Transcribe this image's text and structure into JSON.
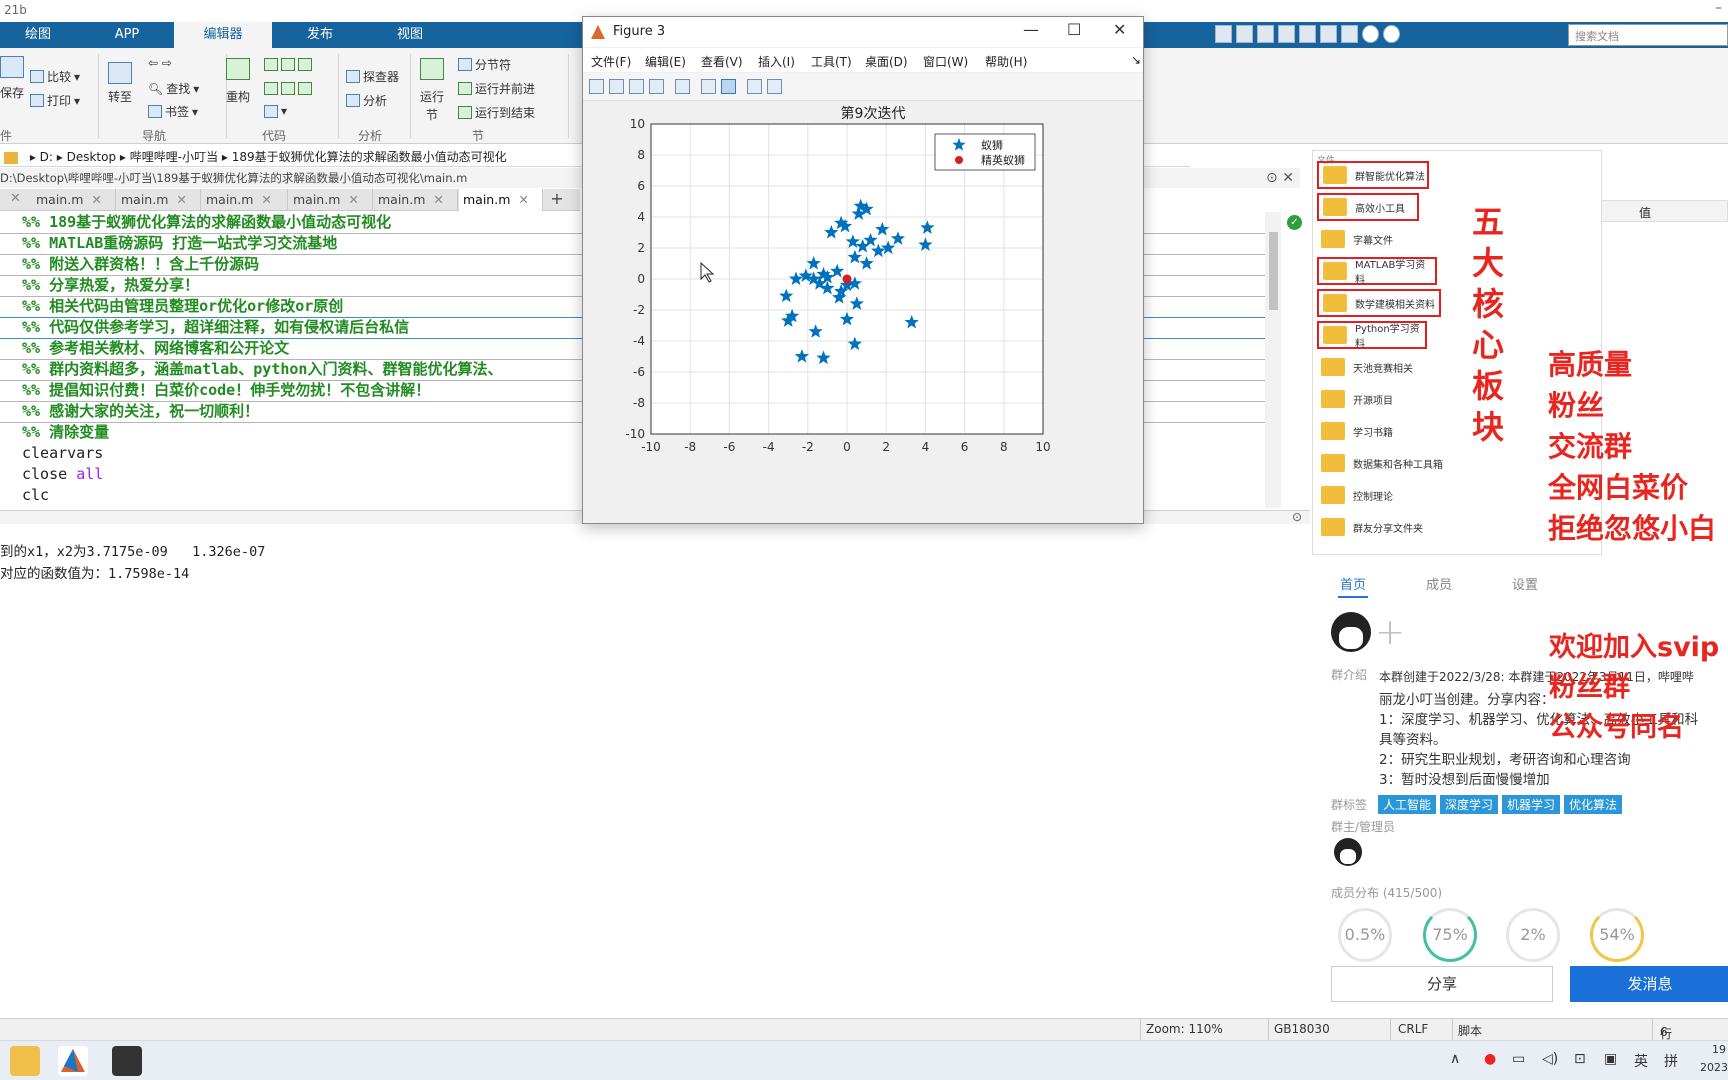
{
  "app": {
    "title_fragment": "21b",
    "minimize": "–"
  },
  "tabs": [
    "绘图",
    "APP",
    "编辑器",
    "发布",
    "视图"
  ],
  "doc_search_placeholder": "搜索文档",
  "ribbon": {
    "file": {
      "save": "保存",
      "section": "件"
    },
    "compare": "比较",
    "print": "打印",
    "goto": "转至",
    "find": "查找",
    "bookmark": "书签",
    "nav_section": "导航",
    "refactor": "重构",
    "code_section": "代码",
    "explorer": "探查器",
    "analyze": "分析",
    "analysis_section": "分析",
    "run_section_btn": "运行节",
    "run_section_top": "运行",
    "run_section_bot": "节",
    "section_break": "分节符",
    "run_advance": "运行并前进",
    "run_to_end": "运行到结束",
    "section_label": "节"
  },
  "address": [
    "D:",
    "Desktop",
    "哔哩哔哩-小叮当",
    "189基于蚁狮优化算法的求解函数最小值动态可视化"
  ],
  "filepath": "D:\\Desktop\\哔哩哔哩-小叮当\\189基于蚁狮优化算法的求解函数最小值动态可视化\\main.m",
  "file_tabs": [
    "main.m",
    "main.m",
    "main.m",
    "main.m",
    "main.m",
    "main.m"
  ],
  "code": {
    "c1": "%% 189基于蚁狮优化算法的求解函数最小值动态可视化",
    "c2": "%% MATLAB重磅源码 打造一站式学习交流基地",
    "c3": "%% 附送入群资格！！含上千份源码",
    "c4": "%% 分享热爱，热爱分享！",
    "c5": "%% 相关代码由管理员整理or优化or修改or原创",
    "c6": "%% 代码仅供参考学习，超详细注释，如有侵权请后台私信",
    "c7": "%% 参考相关教材、网络博客和公开论文",
    "c8": "%% 群内资料超多，涵盖matlab、python入门资料、群智能优化算法、",
    "c9": "%% 提倡知识付费！白菜价code！伸手党勿扰！不包含讲解！",
    "c10": "%% 感谢大家的关注，祝一切顺利！",
    "c11": "%% 清除变量",
    "l12": "clearvars",
    "l13a": "close ",
    "l13b": "all",
    "l14": "clc"
  },
  "cmd": {
    "line1": "到的x1，x2为3.7175e-09   1.326e-07",
    "line2": "对应的函数值为：1.7598e-14"
  },
  "statusbar": {
    "zoom": "Zoom: 110%",
    "encoding": "GB18030",
    "eol": "CRLF",
    "type": "脚本",
    "row_label": "行",
    "row": "6"
  },
  "figure": {
    "title": "Figure 3",
    "menu": [
      "文件(F)",
      "编辑(E)",
      "查看(V)",
      "插入(I)",
      "工具(T)",
      "桌面(D)",
      "窗口(W)",
      "帮助(H)"
    ]
  },
  "chart_data": {
    "type": "scatter",
    "title": "第9次迭代",
    "xlim": [
      -10,
      10
    ],
    "ylim": [
      -10,
      10
    ],
    "xticks": [
      -10,
      -8,
      -6,
      -4,
      -2,
      0,
      2,
      4,
      6,
      8,
      10
    ],
    "yticks": [
      -10,
      -8,
      -6,
      -4,
      -2,
      0,
      2,
      4,
      6,
      8,
      10
    ],
    "grid": true,
    "legend_position": "top-right",
    "series": [
      {
        "name": "蚁狮",
        "marker": "star",
        "color": "#0072bd",
        "points": [
          [
            0.7,
            4.7
          ],
          [
            0.6,
            4.2
          ],
          [
            1.0,
            4.5
          ],
          [
            -0.3,
            3.6
          ],
          [
            -0.1,
            3.4
          ],
          [
            1.8,
            3.2
          ],
          [
            4.1,
            3.3
          ],
          [
            -0.8,
            3.0
          ],
          [
            2.6,
            2.6
          ],
          [
            1.2,
            2.5
          ],
          [
            0.3,
            2.4
          ],
          [
            0.8,
            2.1
          ],
          [
            1.6,
            1.8
          ],
          [
            2.1,
            2.0
          ],
          [
            4.0,
            2.2
          ],
          [
            0.4,
            1.4
          ],
          [
            1.0,
            1.0
          ],
          [
            -1.7,
            1.0
          ],
          [
            -0.5,
            0.5
          ],
          [
            -1.2,
            0.3
          ],
          [
            -1.0,
            0.1
          ],
          [
            -1.7,
            0.0
          ],
          [
            -2.6,
            0.0
          ],
          [
            -2.1,
            0.2
          ],
          [
            -1.4,
            -0.3
          ],
          [
            -1.0,
            -0.6
          ],
          [
            0.4,
            -0.3
          ],
          [
            0.0,
            -0.4
          ],
          [
            -0.3,
            -0.8
          ],
          [
            -0.4,
            -1.2
          ],
          [
            -3.1,
            -1.1
          ],
          [
            0.5,
            -1.6
          ],
          [
            -2.8,
            -2.4
          ],
          [
            -3.0,
            -2.7
          ],
          [
            0.0,
            -2.6
          ],
          [
            3.3,
            -2.8
          ],
          [
            -1.6,
            -3.4
          ],
          [
            0.4,
            -4.2
          ],
          [
            -2.3,
            -5.0
          ],
          [
            -1.2,
            -5.1
          ]
        ]
      },
      {
        "name": "精英蚁狮",
        "marker": "dot",
        "color": "#d42020",
        "points": [
          [
            0.0,
            0.0
          ]
        ]
      }
    ]
  },
  "folders": {
    "header": "文件",
    "items": [
      "群智能优化算法",
      "高效小工具",
      "字幕文件",
      "MATLAB学习资料",
      "数学建模相关资料",
      "Python学习资料",
      "天池竞赛相关",
      "开源项目",
      "学习书籍",
      "数据集和各种工具箱",
      "控制理论",
      "群友分享文件夹"
    ]
  },
  "variables": {
    "value_header": "值"
  },
  "overlay": {
    "core": [
      "五",
      "大",
      "核",
      "心",
      "板",
      "块"
    ],
    "lines": [
      "高质量",
      "粉丝",
      "交流群",
      "全网白菜价",
      "拒绝忽悠小白"
    ],
    "join": [
      "欢迎加入svip",
      "粉丝群",
      "公众号同名"
    ]
  },
  "group": {
    "tabs": [
      "首页",
      "成员",
      "设置"
    ],
    "intro_label": "群介绍",
    "intro": [
      "本群创建于2022/3/28: 本群建于2022年3月11日，哔哩哔",
      "丽龙小叮当创建。分享内容：",
      "1：深度学习、机器学习、优化算法、高效小工具和科",
      "具等资料。",
      "2：研究生职业规划，考研咨询和心理咨询",
      "3：暂时没想到后面慢慢增加"
    ],
    "tags_label": "群标签",
    "tags": [
      "人工智能",
      "深度学习",
      "机器学习",
      "优化算法"
    ],
    "admin_label": "群主/管理员",
    "dist_label": "成员分布",
    "dist_count": "(415/500)",
    "dist": [
      {
        "value": "0.5%",
        "color": "#e6e6e6"
      },
      {
        "value": "75%",
        "color": "#43c0a0"
      },
      {
        "value": "2%",
        "color": "#e6e6e6"
      },
      {
        "value": "54%",
        "color": "#f1c545"
      }
    ],
    "share": "分享",
    "send": "发消息"
  },
  "tray": {
    "ime": "英",
    "ime2": "拼",
    "clock_top": "19",
    "clock_bot": "2023"
  }
}
